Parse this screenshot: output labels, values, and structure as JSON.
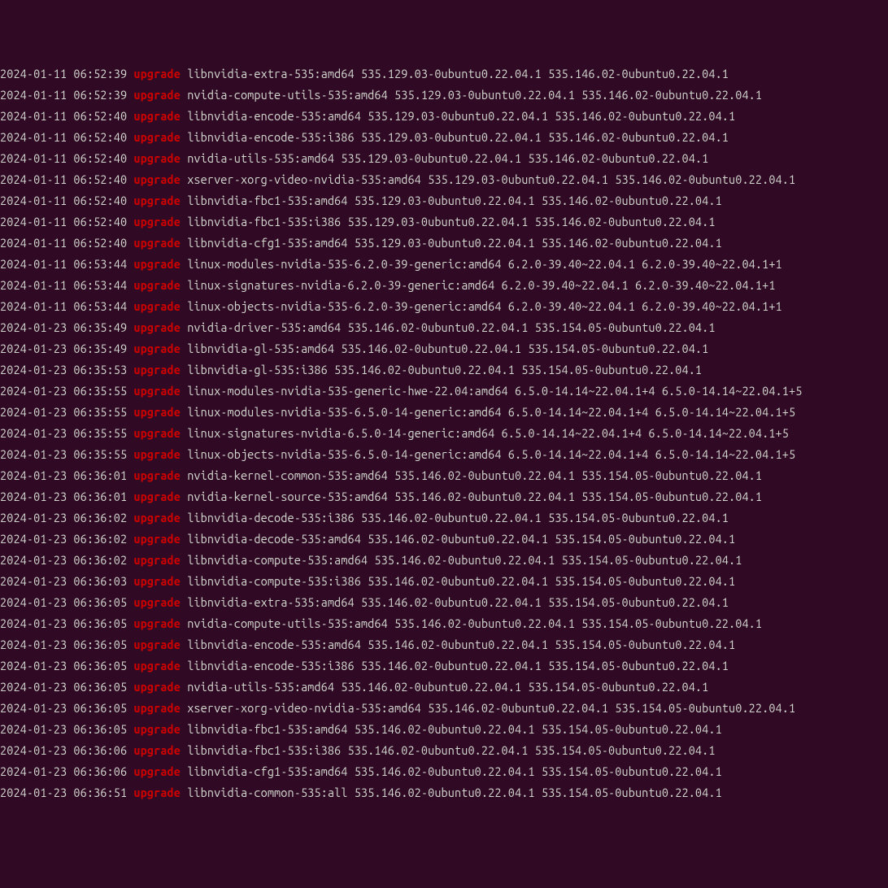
{
  "lines": [
    {
      "ts": "2024-01-11 06:52:39",
      "kw": "upgrade",
      "rest": "libnvidia-extra-535:amd64 535.129.03-0ubuntu0.22.04.1 535.146.02-0ubuntu0.22.04.1"
    },
    {
      "ts": "2024-01-11 06:52:39",
      "kw": "upgrade",
      "rest": "nvidia-compute-utils-535:amd64 535.129.03-0ubuntu0.22.04.1 535.146.02-0ubuntu0.22.04.1"
    },
    {
      "ts": "2024-01-11 06:52:40",
      "kw": "upgrade",
      "rest": "libnvidia-encode-535:amd64 535.129.03-0ubuntu0.22.04.1 535.146.02-0ubuntu0.22.04.1"
    },
    {
      "ts": "2024-01-11 06:52:40",
      "kw": "upgrade",
      "rest": "libnvidia-encode-535:i386 535.129.03-0ubuntu0.22.04.1 535.146.02-0ubuntu0.22.04.1"
    },
    {
      "ts": "2024-01-11 06:52:40",
      "kw": "upgrade",
      "rest": "nvidia-utils-535:amd64 535.129.03-0ubuntu0.22.04.1 535.146.02-0ubuntu0.22.04.1"
    },
    {
      "ts": "2024-01-11 06:52:40",
      "kw": "upgrade",
      "rest": "xserver-xorg-video-nvidia-535:amd64 535.129.03-0ubuntu0.22.04.1 535.146.02-0ubuntu0.22.04.1"
    },
    {
      "ts": "2024-01-11 06:52:40",
      "kw": "upgrade",
      "rest": "libnvidia-fbc1-535:amd64 535.129.03-0ubuntu0.22.04.1 535.146.02-0ubuntu0.22.04.1"
    },
    {
      "ts": "2024-01-11 06:52:40",
      "kw": "upgrade",
      "rest": "libnvidia-fbc1-535:i386 535.129.03-0ubuntu0.22.04.1 535.146.02-0ubuntu0.22.04.1"
    },
    {
      "ts": "2024-01-11 06:52:40",
      "kw": "upgrade",
      "rest": "libnvidia-cfg1-535:amd64 535.129.03-0ubuntu0.22.04.1 535.146.02-0ubuntu0.22.04.1"
    },
    {
      "ts": "2024-01-11 06:53:44",
      "kw": "upgrade",
      "rest": "linux-modules-nvidia-535-6.2.0-39-generic:amd64 6.2.0-39.40~22.04.1 6.2.0-39.40~22.04.1+1"
    },
    {
      "ts": "2024-01-11 06:53:44",
      "kw": "upgrade",
      "rest": "linux-signatures-nvidia-6.2.0-39-generic:amd64 6.2.0-39.40~22.04.1 6.2.0-39.40~22.04.1+1"
    },
    {
      "ts": "2024-01-11 06:53:44",
      "kw": "upgrade",
      "rest": "linux-objects-nvidia-535-6.2.0-39-generic:amd64 6.2.0-39.40~22.04.1 6.2.0-39.40~22.04.1+1"
    },
    {
      "ts": "2024-01-23 06:35:49",
      "kw": "upgrade",
      "rest": "nvidia-driver-535:amd64 535.146.02-0ubuntu0.22.04.1 535.154.05-0ubuntu0.22.04.1"
    },
    {
      "ts": "2024-01-23 06:35:49",
      "kw": "upgrade",
      "rest": "libnvidia-gl-535:amd64 535.146.02-0ubuntu0.22.04.1 535.154.05-0ubuntu0.22.04.1"
    },
    {
      "ts": "2024-01-23 06:35:53",
      "kw": "upgrade",
      "rest": "libnvidia-gl-535:i386 535.146.02-0ubuntu0.22.04.1 535.154.05-0ubuntu0.22.04.1"
    },
    {
      "ts": "2024-01-23 06:35:55",
      "kw": "upgrade",
      "rest": "linux-modules-nvidia-535-generic-hwe-22.04:amd64 6.5.0-14.14~22.04.1+4 6.5.0-14.14~22.04.1+5"
    },
    {
      "ts": "2024-01-23 06:35:55",
      "kw": "upgrade",
      "rest": "linux-modules-nvidia-535-6.5.0-14-generic:amd64 6.5.0-14.14~22.04.1+4 6.5.0-14.14~22.04.1+5"
    },
    {
      "ts": "2024-01-23 06:35:55",
      "kw": "upgrade",
      "rest": "linux-signatures-nvidia-6.5.0-14-generic:amd64 6.5.0-14.14~22.04.1+4 6.5.0-14.14~22.04.1+5"
    },
    {
      "ts": "2024-01-23 06:35:55",
      "kw": "upgrade",
      "rest": "linux-objects-nvidia-535-6.5.0-14-generic:amd64 6.5.0-14.14~22.04.1+4 6.5.0-14.14~22.04.1+5"
    },
    {
      "ts": "2024-01-23 06:36:01",
      "kw": "upgrade",
      "rest": "nvidia-kernel-common-535:amd64 535.146.02-0ubuntu0.22.04.1 535.154.05-0ubuntu0.22.04.1"
    },
    {
      "ts": "2024-01-23 06:36:01",
      "kw": "upgrade",
      "rest": "nvidia-kernel-source-535:amd64 535.146.02-0ubuntu0.22.04.1 535.154.05-0ubuntu0.22.04.1"
    },
    {
      "ts": "2024-01-23 06:36:02",
      "kw": "upgrade",
      "rest": "libnvidia-decode-535:i386 535.146.02-0ubuntu0.22.04.1 535.154.05-0ubuntu0.22.04.1"
    },
    {
      "ts": "2024-01-23 06:36:02",
      "kw": "upgrade",
      "rest": "libnvidia-decode-535:amd64 535.146.02-0ubuntu0.22.04.1 535.154.05-0ubuntu0.22.04.1"
    },
    {
      "ts": "2024-01-23 06:36:02",
      "kw": "upgrade",
      "rest": "libnvidia-compute-535:amd64 535.146.02-0ubuntu0.22.04.1 535.154.05-0ubuntu0.22.04.1"
    },
    {
      "ts": "2024-01-23 06:36:03",
      "kw": "upgrade",
      "rest": "libnvidia-compute-535:i386 535.146.02-0ubuntu0.22.04.1 535.154.05-0ubuntu0.22.04.1"
    },
    {
      "ts": "2024-01-23 06:36:05",
      "kw": "upgrade",
      "rest": "libnvidia-extra-535:amd64 535.146.02-0ubuntu0.22.04.1 535.154.05-0ubuntu0.22.04.1"
    },
    {
      "ts": "2024-01-23 06:36:05",
      "kw": "upgrade",
      "rest": "nvidia-compute-utils-535:amd64 535.146.02-0ubuntu0.22.04.1 535.154.05-0ubuntu0.22.04.1"
    },
    {
      "ts": "2024-01-23 06:36:05",
      "kw": "upgrade",
      "rest": "libnvidia-encode-535:amd64 535.146.02-0ubuntu0.22.04.1 535.154.05-0ubuntu0.22.04.1"
    },
    {
      "ts": "2024-01-23 06:36:05",
      "kw": "upgrade",
      "rest": "libnvidia-encode-535:i386 535.146.02-0ubuntu0.22.04.1 535.154.05-0ubuntu0.22.04.1"
    },
    {
      "ts": "2024-01-23 06:36:05",
      "kw": "upgrade",
      "rest": "nvidia-utils-535:amd64 535.146.02-0ubuntu0.22.04.1 535.154.05-0ubuntu0.22.04.1"
    },
    {
      "ts": "2024-01-23 06:36:05",
      "kw": "upgrade",
      "rest": "xserver-xorg-video-nvidia-535:amd64 535.146.02-0ubuntu0.22.04.1 535.154.05-0ubuntu0.22.04.1"
    },
    {
      "ts": "2024-01-23 06:36:05",
      "kw": "upgrade",
      "rest": "libnvidia-fbc1-535:amd64 535.146.02-0ubuntu0.22.04.1 535.154.05-0ubuntu0.22.04.1"
    },
    {
      "ts": "2024-01-23 06:36:06",
      "kw": "upgrade",
      "rest": "libnvidia-fbc1-535:i386 535.146.02-0ubuntu0.22.04.1 535.154.05-0ubuntu0.22.04.1"
    },
    {
      "ts": "2024-01-23 06:36:06",
      "kw": "upgrade",
      "rest": "libnvidia-cfg1-535:amd64 535.146.02-0ubuntu0.22.04.1 535.154.05-0ubuntu0.22.04.1"
    },
    {
      "ts": "2024-01-23 06:36:51",
      "kw": "upgrade",
      "rest": "libnvidia-common-535:all 535.146.02-0ubuntu0.22.04.1 535.154.05-0ubuntu0.22.04.1"
    }
  ]
}
